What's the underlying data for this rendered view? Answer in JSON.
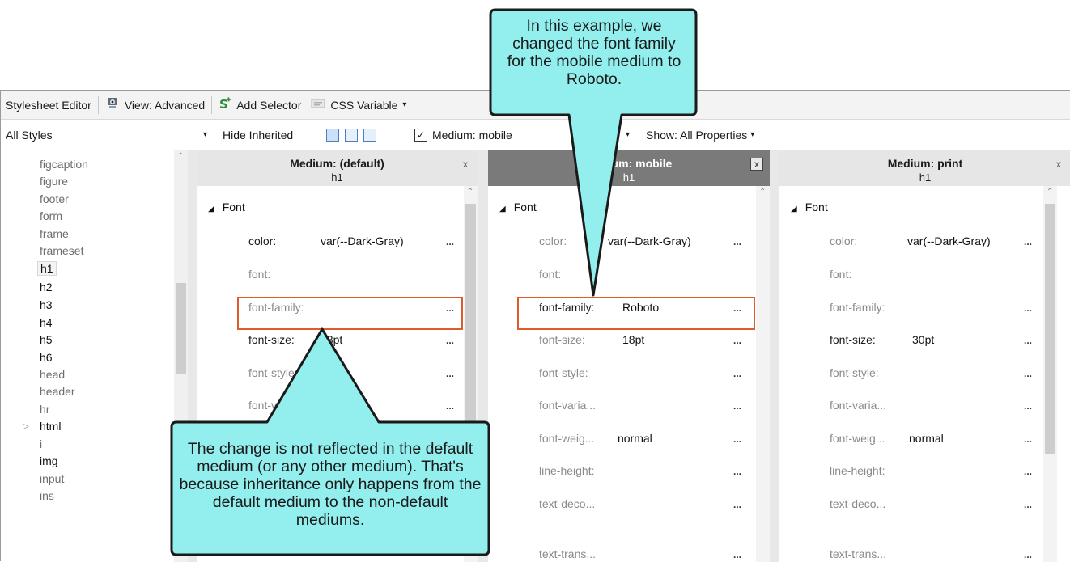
{
  "toolbar": {
    "title": "Stylesheet Editor",
    "view": "View: Advanced",
    "add_selector": "Add Selector",
    "css_variable": "CSS Variable"
  },
  "filters": {
    "styles_select": "All Styles",
    "hide_inherited": "Hide Inherited",
    "medium_checked": true,
    "medium_label": "Medium: mobile",
    "show": "Show: All Properties"
  },
  "selectors": [
    "figcaption",
    "figure",
    "footer",
    "form",
    "frame",
    "frameset",
    "h1",
    "h2",
    "h3",
    "h4",
    "h5",
    "h6",
    "head",
    "header",
    "hr",
    "html",
    "i",
    "img",
    "input",
    "ins"
  ],
  "panels": [
    {
      "title": "Medium: (default)",
      "subtitle": "h1",
      "close": "x",
      "group": "Font",
      "props": [
        {
          "name": "color:",
          "value": "var(--Dark-Gray)",
          "dots": "..."
        },
        {
          "name": "font:",
          "value": "",
          "dots": ""
        },
        {
          "name": "font-family:",
          "value": "",
          "dots": "..."
        },
        {
          "name": "font-size:",
          "value": "18pt",
          "dots": "..."
        },
        {
          "name": "font-style:",
          "value": "",
          "dots": "..."
        },
        {
          "name": "font-variant:",
          "value": "",
          "dots": "..."
        }
      ],
      "extra": {
        "name": "text-trans...",
        "dots": "..."
      }
    },
    {
      "title": "Medium: mobile",
      "subtitle": "h1",
      "close": "x",
      "group": "Font",
      "props": [
        {
          "name": "color:",
          "value": "var(--Dark-Gray)",
          "dots": "..."
        },
        {
          "name": "font:",
          "value": "",
          "dots": ""
        },
        {
          "name": "font-family:",
          "value": "Roboto",
          "dots": "..."
        },
        {
          "name": "font-size:",
          "value": "18pt",
          "dots": "..."
        },
        {
          "name": "font-style:",
          "value": "",
          "dots": "..."
        },
        {
          "name": "font-varia...",
          "value": "",
          "dots": "..."
        },
        {
          "name": "font-weig...",
          "value": "normal",
          "dots": "..."
        },
        {
          "name": "line-height:",
          "value": "",
          "dots": "..."
        },
        {
          "name": "text-deco...",
          "value": "",
          "dots": "..."
        },
        {
          "name": "text-trans...",
          "value": "",
          "dots": "..."
        }
      ]
    },
    {
      "title": "Medium: print",
      "subtitle": "h1",
      "close": "x",
      "group": "Font",
      "props": [
        {
          "name": "color:",
          "value": "var(--Dark-Gray)",
          "dots": "..."
        },
        {
          "name": "font:",
          "value": "",
          "dots": ""
        },
        {
          "name": "font-family:",
          "value": "",
          "dots": "..."
        },
        {
          "name": "font-size:",
          "value": "30pt",
          "dots": "..."
        },
        {
          "name": "font-style:",
          "value": "",
          "dots": "..."
        },
        {
          "name": "font-varia...",
          "value": "",
          "dots": "..."
        },
        {
          "name": "font-weig...",
          "value": "normal",
          "dots": "..."
        },
        {
          "name": "line-height:",
          "value": "",
          "dots": "..."
        },
        {
          "name": "text-deco...",
          "value": "",
          "dots": "..."
        },
        {
          "name": "text-trans...",
          "value": "",
          "dots": "..."
        }
      ]
    }
  ],
  "callouts": {
    "top": "In this example, we changed the font family for the mobile medium to Roboto.",
    "bottom": "The change is not reflected in the default medium (or any other medium). That's because inheritance only happens from the default medium to the non-default mediums."
  },
  "colors": {
    "callout_fill": "#93eeee",
    "highlight": "#e05a2b"
  }
}
